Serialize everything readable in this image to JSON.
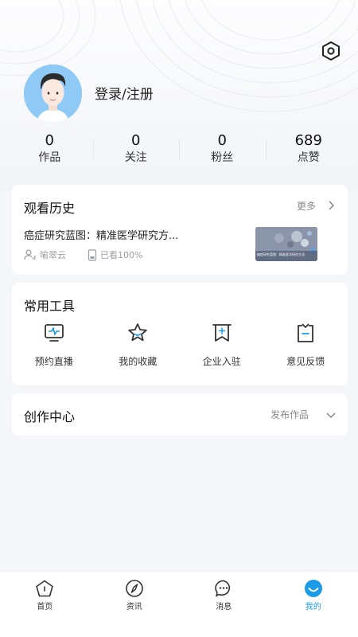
{
  "header": {
    "login_label": "登录/注册",
    "settings_icon": "hexagon-gear-icon",
    "avatar_icon": "default-avatar"
  },
  "stats": [
    {
      "value": "0",
      "label": "作品"
    },
    {
      "value": "0",
      "label": "关注"
    },
    {
      "value": "0",
      "label": "粉丝"
    },
    {
      "value": "689",
      "label": "点赞"
    }
  ],
  "history": {
    "title": "观看历史",
    "more_label": "更多",
    "item": {
      "title": "癌症研究蓝图：精准医学研究方...",
      "author": "喻翠云",
      "progress_text": "已看100%",
      "progress": 1.0,
      "thumb_caption": "癌症研究蓝图：精准医学研究方法"
    }
  },
  "tools": {
    "title": "常用工具",
    "items": [
      {
        "label": "预约直播",
        "icon": "monitor-pulse-icon"
      },
      {
        "label": "我的收藏",
        "icon": "star-icon"
      },
      {
        "label": "企业入驻",
        "icon": "bookmark-plus-icon"
      },
      {
        "label": "意见反馈",
        "icon": "clipboard-minus-icon"
      }
    ]
  },
  "creation": {
    "title": "创作中心",
    "action_label": "发布作品"
  },
  "tabbar": {
    "active_color": "#1e9be8",
    "items": [
      {
        "label": "首页",
        "icon": "home-icon",
        "active": false
      },
      {
        "label": "资讯",
        "icon": "compass-icon",
        "active": false
      },
      {
        "label": "消息",
        "icon": "chat-icon",
        "active": false
      },
      {
        "label": "我的",
        "icon": "smile-icon",
        "active": true
      }
    ]
  }
}
